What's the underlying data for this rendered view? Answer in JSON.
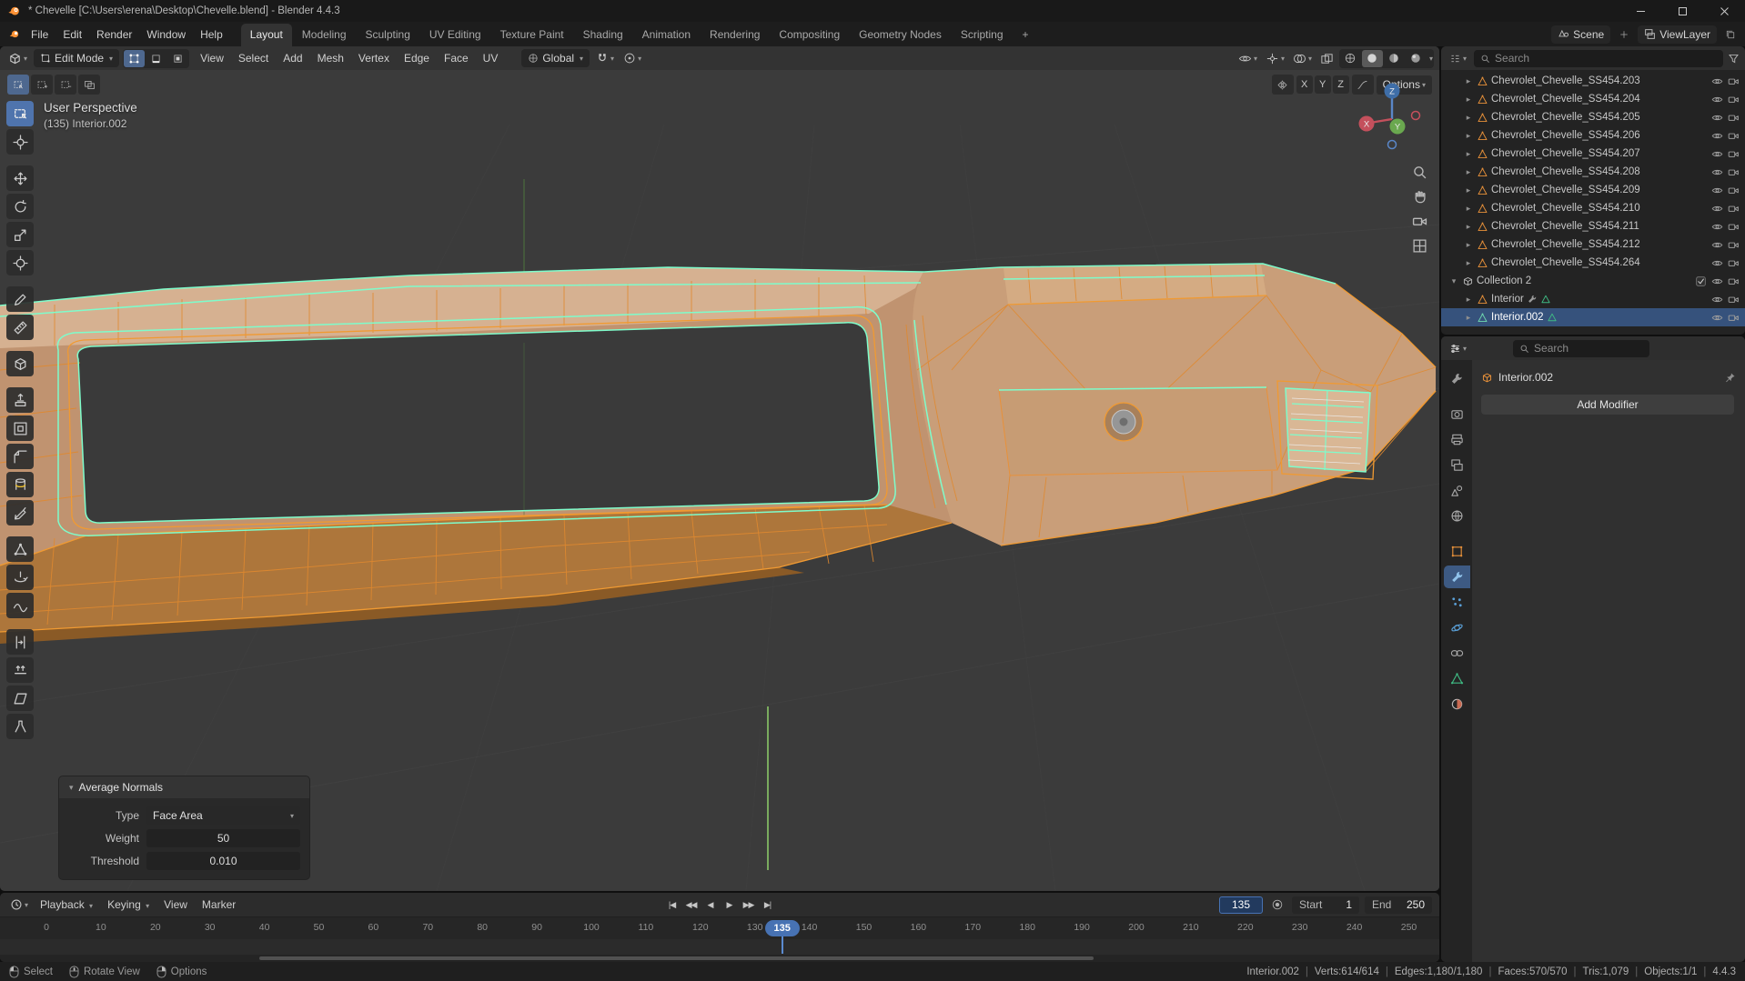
{
  "title_bar": {
    "title": "* Chevelle [C:\\Users\\erena\\Desktop\\Chevelle.blend] - Blender 4.4.3"
  },
  "top_bar": {
    "menus": [
      "File",
      "Edit",
      "Render",
      "Window",
      "Help"
    ],
    "workspaces": [
      "Layout",
      "Modeling",
      "Sculpting",
      "UV Editing",
      "Texture Paint",
      "Shading",
      "Animation",
      "Rendering",
      "Compositing",
      "Geometry Nodes",
      "Scripting"
    ],
    "active_workspace": "Layout",
    "new_workspace": "+",
    "scene_name": "Scene",
    "view_layer_name": "ViewLayer"
  },
  "viewport": {
    "header": {
      "mode": "Edit Mode",
      "menus": [
        "View",
        "Select",
        "Add",
        "Mesh",
        "Vertex",
        "Edge",
        "Face",
        "UV"
      ],
      "orientation": "Global"
    },
    "tool_settings": {
      "axes": [
        "X",
        "Y",
        "Z"
      ],
      "options_label": "Options"
    },
    "overlay": {
      "view_label": "User Perspective",
      "object_label": "(135) Interior.002"
    },
    "gizmo_axes": [
      "X",
      "Y",
      "Z"
    ],
    "tools": [
      "select-box",
      "cursor",
      "move",
      "rotate",
      "scale",
      "transform",
      "annotate",
      "measure",
      "add-cube",
      "extrude-region",
      "inset-faces",
      "bevel",
      "loop-cut",
      "knife",
      "poly-build",
      "spin",
      "smooth",
      "edge-slide",
      "shrink-fatten",
      "shear",
      "rip-region"
    ]
  },
  "operator_panel": {
    "title": "Average Normals",
    "type_label": "Type",
    "type_value": "Face Area",
    "weight_label": "Weight",
    "weight_value": "50",
    "threshold_label": "Threshold",
    "threshold_value": "0.010"
  },
  "outliner": {
    "search_placeholder": "Search",
    "items": [
      {
        "name": "Chevrolet_Chevelle_SS454.203",
        "kind": "mesh"
      },
      {
        "name": "Chevrolet_Chevelle_SS454.204",
        "kind": "mesh"
      },
      {
        "name": "Chevrolet_Chevelle_SS454.205",
        "kind": "mesh"
      },
      {
        "name": "Chevrolet_Chevelle_SS454.206",
        "kind": "mesh"
      },
      {
        "name": "Chevrolet_Chevelle_SS454.207",
        "kind": "mesh"
      },
      {
        "name": "Chevrolet_Chevelle_SS454.208",
        "kind": "mesh"
      },
      {
        "name": "Chevrolet_Chevelle_SS454.209",
        "kind": "mesh"
      },
      {
        "name": "Chevrolet_Chevelle_SS454.210",
        "kind": "mesh"
      },
      {
        "name": "Chevrolet_Chevelle_SS454.211",
        "kind": "mesh"
      },
      {
        "name": "Chevrolet_Chevelle_SS454.212",
        "kind": "mesh"
      },
      {
        "name": "Chevrolet_Chevelle_SS454.264",
        "kind": "mesh"
      },
      {
        "name": "Collection 2",
        "kind": "collection",
        "expanded": true
      },
      {
        "name": "Interior",
        "kind": "mesh",
        "extras": [
          "wrench",
          "data"
        ]
      },
      {
        "name": "Interior.002",
        "kind": "mesh",
        "selected": true,
        "extras": [
          "data"
        ]
      }
    ]
  },
  "properties": {
    "search_placeholder": "Search",
    "breadcrumb": "Interior.002",
    "add_modifier_label": "Add Modifier",
    "tabs": [
      "tool",
      "render",
      "output",
      "view-layer",
      "scene",
      "world",
      "object",
      "modifiers",
      "particles",
      "physics",
      "constraints",
      "data",
      "material"
    ],
    "active_tab": "modifiers"
  },
  "timeline": {
    "menus": [
      "Playback",
      "Keying",
      "View",
      "Marker"
    ],
    "playback_buttons": [
      {
        "name": "jump-to-start",
        "glyph": "|◀"
      },
      {
        "name": "jump-to-prev-keyframe",
        "glyph": "◀◀"
      },
      {
        "name": "play-reverse",
        "glyph": "◀"
      },
      {
        "name": "play",
        "glyph": "▶"
      },
      {
        "name": "jump-to-next-keyframe",
        "glyph": "▶▶"
      },
      {
        "name": "jump-to-end",
        "glyph": "▶|"
      }
    ],
    "current_frame": "135",
    "start_label": "Start",
    "start_value": "1",
    "end_label": "End",
    "end_value": "250",
    "ticks": [
      "0",
      "10",
      "20",
      "30",
      "40",
      "50",
      "60",
      "70",
      "80",
      "90",
      "100",
      "110",
      "120",
      "130",
      "140",
      "150",
      "160",
      "170",
      "180",
      "190",
      "200",
      "210",
      "220",
      "230",
      "240",
      "250"
    ]
  },
  "status_bar": {
    "hints": [
      "Select",
      "Rotate View",
      "Options"
    ],
    "stats": [
      "Interior.002",
      "Verts:614/614",
      "Edges:1,180/1,180",
      "Faces:570/570",
      "Tris:1,079",
      "Objects:1/1",
      "4.4.3"
    ]
  }
}
